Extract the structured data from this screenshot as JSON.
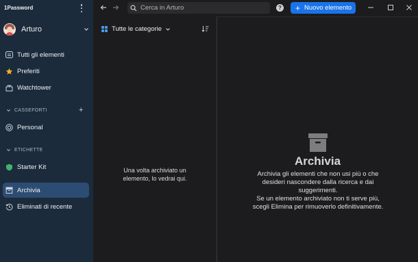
{
  "app": {
    "title": "1Password"
  },
  "account": {
    "name": "Arturo"
  },
  "sidebar": {
    "items": [
      {
        "label": "Tutti gli elementi",
        "icon": "all-items-icon"
      },
      {
        "label": "Preferiti",
        "icon": "star-icon"
      },
      {
        "label": "Watchtower",
        "icon": "watchtower-icon"
      }
    ],
    "vaults_header": "CASSEFORTI",
    "vaults": [
      {
        "label": "Personal",
        "icon": "vault-icon"
      }
    ],
    "tags_header": "ETICHETTE",
    "tags": [
      {
        "label": "Starter Kit",
        "icon": "tag-icon"
      }
    ],
    "archive": {
      "label": "Archivia",
      "icon": "archive-icon",
      "active": true
    },
    "recently_deleted": {
      "label": "Eliminati di recente",
      "icon": "history-icon"
    }
  },
  "toolbar": {
    "search_placeholder": "Cerca in Arturo",
    "help_label": "?",
    "new_item_label": "Nuovo elemento"
  },
  "list": {
    "category_label": "Tutte le categorie",
    "empty_line1": "Una volta archiviato un",
    "empty_line2": "elemento, lo vedrai qui."
  },
  "detail": {
    "title": "Archivia",
    "desc_lines": [
      "Archivia gli elementi che non usi più o che",
      "desideri nascondere dalla ricerca e dai",
      "suggerimenti.",
      "Se un elemento archiviato non ti serve più,",
      "scegli Elimina per rimuoverlo definitivamente."
    ]
  },
  "colors": {
    "sidebar_bg": "#1b2b3c",
    "active_item": "#2c4c74",
    "accent": "#1a73e8",
    "main_bg": "#1c1c1e"
  }
}
